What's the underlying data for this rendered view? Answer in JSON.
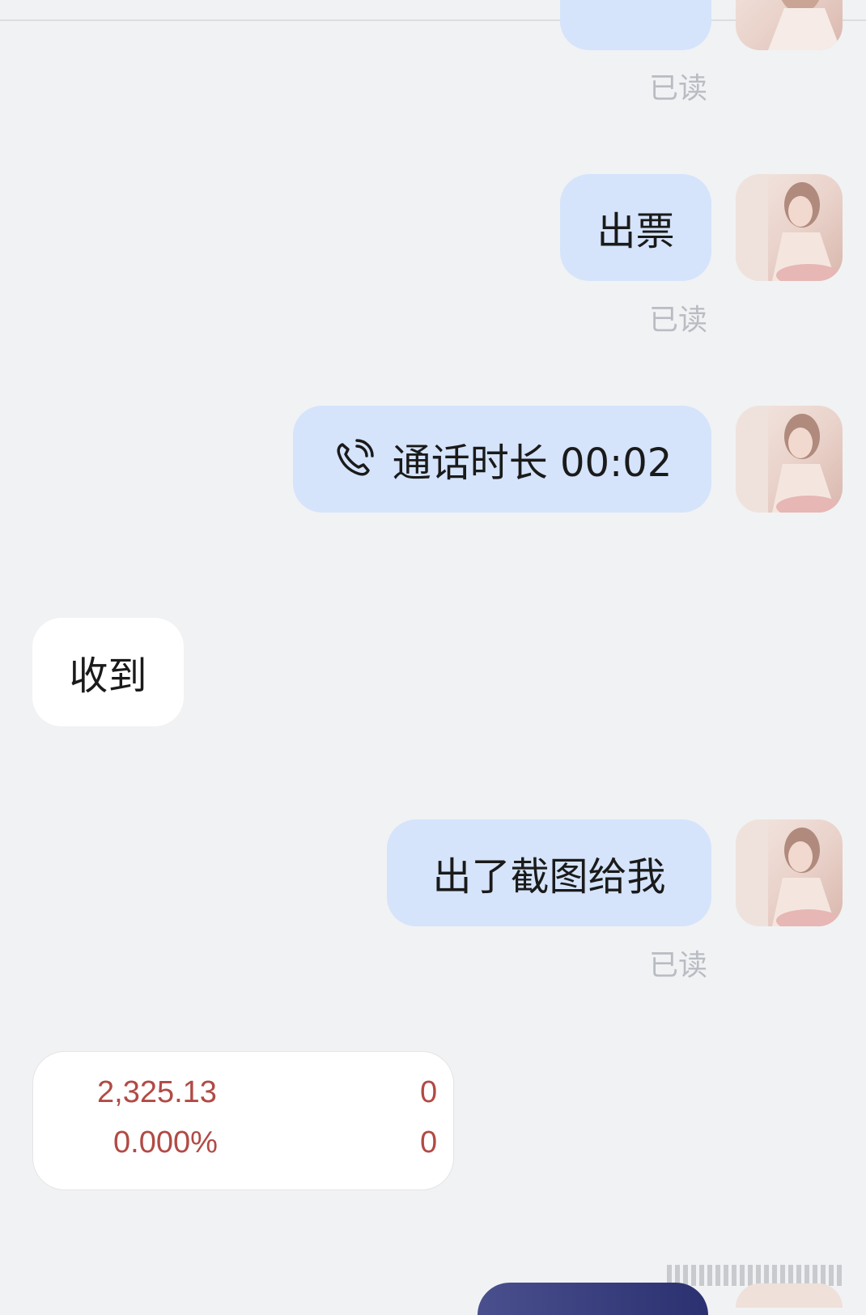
{
  "chat": {
    "read_label": "已读",
    "messages": {
      "m1": "出票",
      "m2_call": "通话时长 00:02",
      "m3": "收到",
      "m4": "出了截图给我"
    }
  },
  "screenshot_card": {
    "left_top": "2,325.13",
    "left_bottom": "0.000%",
    "right_top": "0",
    "right_bottom": "0"
  },
  "icons": {
    "call": "phone-call-icon"
  },
  "colors": {
    "sent_bubble": "#d5e4fb",
    "recv_bubble": "#ffffff",
    "background": "#f1f2f4",
    "stat_text": "#b14a45"
  }
}
